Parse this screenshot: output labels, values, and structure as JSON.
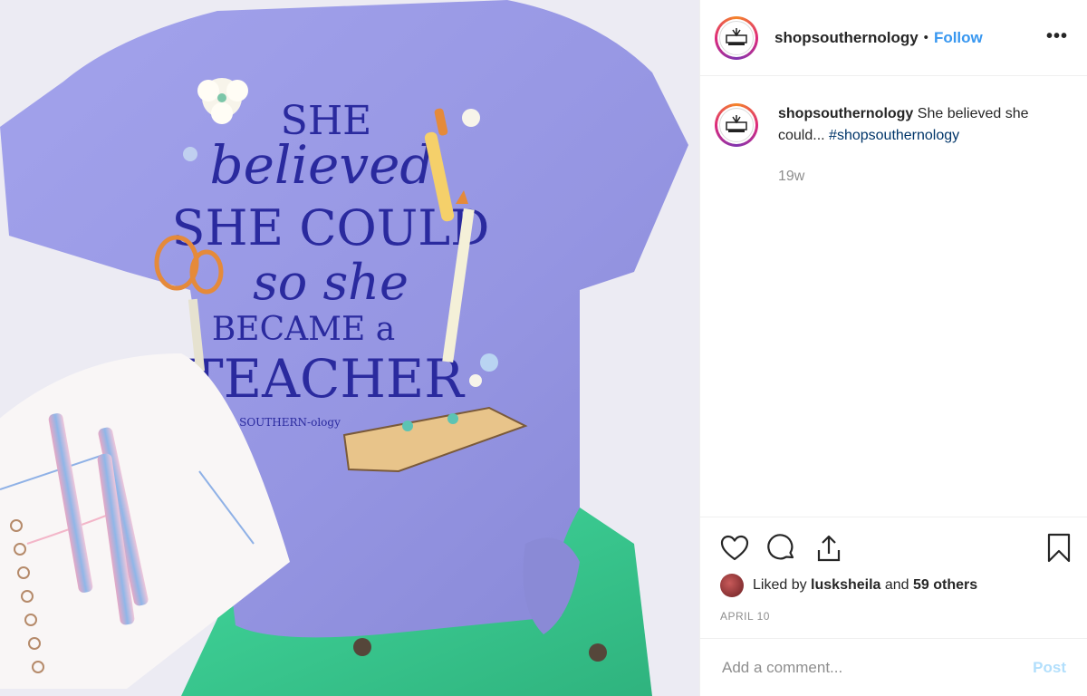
{
  "post": {
    "username": "shopsouthernology",
    "follow_label": "Follow",
    "separator": "•",
    "more_label": "•••",
    "caption_text": "She believed she could...",
    "hashtag": "#shopsouthernology",
    "time_ago": "19w",
    "liked_by_prefix": "Liked by",
    "liked_by_user": "lusksheila",
    "liked_by_and": "and",
    "liked_by_others": "59 others",
    "date": "APRIL 10",
    "comment_placeholder": "Add a comment...",
    "post_label": "Post"
  },
  "photo": {
    "shirt_text": [
      "SHE",
      "believed",
      "SHE COULD",
      "so she",
      "BECAME a",
      "TEACHER"
    ],
    "shirt_brand": "SOUTHERN-ology"
  },
  "colors": {
    "accent": "#3897f0",
    "hashtag": "#003569",
    "shirt": "#9a9ae6",
    "shorts": "#3ed397",
    "shirt_ink": "#2a2a9e"
  },
  "icons": [
    "heart-icon",
    "comment-icon",
    "share-icon",
    "bookmark-icon",
    "more-icon"
  ]
}
